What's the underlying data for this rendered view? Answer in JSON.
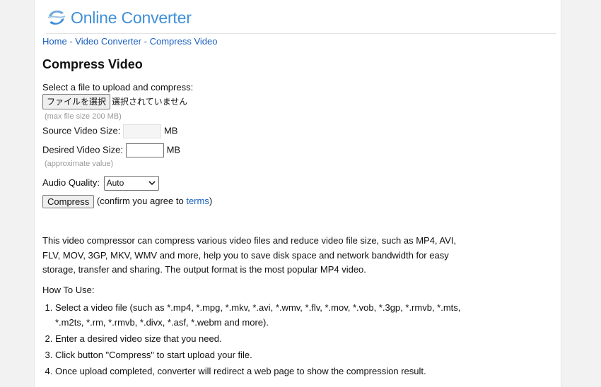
{
  "header": {
    "title": "Online Converter",
    "logo_icon": "swirl-logo-icon"
  },
  "breadcrumb": {
    "home": "Home",
    "video_converter": "Video Converter",
    "current": "Compress Video",
    "separator": "-"
  },
  "page_title": "Compress Video",
  "form": {
    "select_label": "Select a file to upload and compress:",
    "file_button": "ファイルを選択",
    "file_status": "選択されていません",
    "max_size_hint": "(max file size 200 MB)",
    "source_size_label": "Source Video Size:",
    "source_size_value": "",
    "unit": "MB",
    "desired_size_label": "Desired Video Size:",
    "desired_size_value": "",
    "approx_hint": "(approximate value)",
    "audio_label": "Audio Quality:",
    "audio_value": "Auto",
    "compress_button": "Compress",
    "confirm_prefix": "(confirm you agree to",
    "terms_link": "terms",
    "confirm_suffix": ")"
  },
  "description": "This video compressor can compress various video files and reduce video file size, such as MP4, AVI, FLV, MOV, 3GP, MKV, WMV and more, help you to save disk space and network bandwidth for easy storage, transfer and sharing. The output format is the most popular MP4 video.",
  "how_to": {
    "heading": "How To Use:",
    "steps": [
      "Select a video file (such as *.mp4, *.mpg, *.mkv, *.avi, *.wmv, *.flv, *.mov, *.vob, *.3gp, *.rmvb, *.mts, *.m2ts, *.rm, *.rmvb, *.divx, *.asf, *.webm and more).",
      "Enter a desired video size that you need.",
      "Click button \"Compress\" to start upload your file.",
      "Once upload completed, converter will redirect a web page to show the compression result."
    ]
  },
  "colors": {
    "brand": "#3f8fd8",
    "link": "#1a5fc0",
    "hint": "#9a9a9a"
  }
}
